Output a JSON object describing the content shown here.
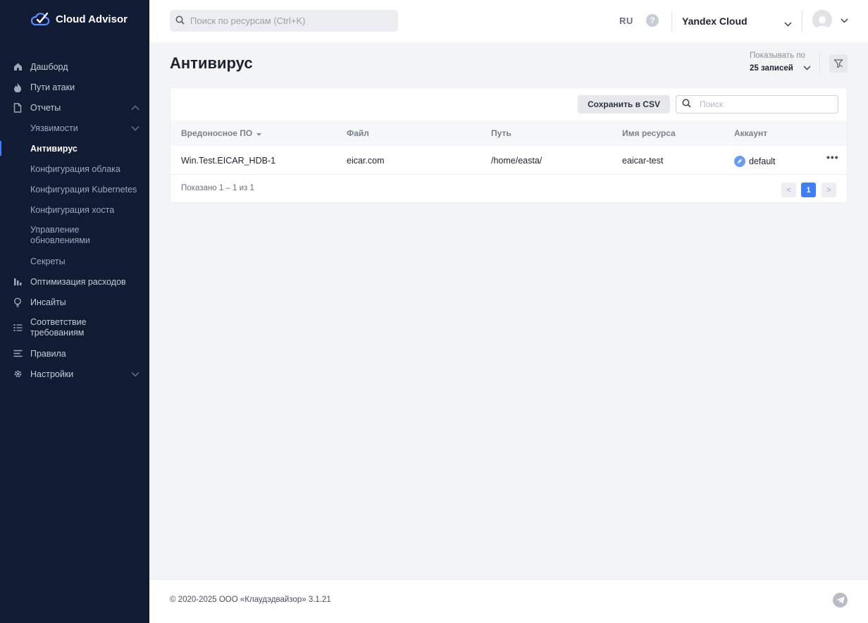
{
  "app": {
    "name": "Cloud Advisor"
  },
  "sidebar": {
    "items": [
      {
        "label": "Дашборд",
        "icon": "home-icon"
      },
      {
        "label": "Пути атаки",
        "icon": "flame-icon"
      },
      {
        "label": "Отчеты",
        "icon": "document-icon",
        "expanded": true
      },
      {
        "label": "Уязвимости",
        "sub": true,
        "expanded": false
      },
      {
        "label": "Антивирус",
        "sub": true,
        "active": true
      },
      {
        "label": "Конфигурация облака",
        "sub": true
      },
      {
        "label": "Конфигурация Kubernetes",
        "sub": true
      },
      {
        "label": "Конфигурация хоста",
        "sub": true
      },
      {
        "label": "Управление обновлениями",
        "sub": true
      },
      {
        "label": "Секреты",
        "sub": true
      },
      {
        "label": "Оптимизация расходов",
        "icon": "bar-chart-icon"
      },
      {
        "label": "Инсайты",
        "icon": "lightbulb-icon"
      },
      {
        "label": "Соответствие требованиям",
        "icon": "checklist-icon"
      },
      {
        "label": "Правила",
        "icon": "rules-icon"
      },
      {
        "label": "Настройки",
        "icon": "gear-icon",
        "expanded": false
      }
    ]
  },
  "header": {
    "search_placeholder": "Поиск по ресурсам (Ctrl+K)",
    "lang": "RU",
    "help": "?",
    "cloud": "Yandex Cloud"
  },
  "main": {
    "title": "Антивирус",
    "show_by_label": "Показывать по",
    "show_by_value": "25 записей",
    "csv_button": "Сохранить в CSV",
    "table_search_placeholder": "Поиск",
    "columns": [
      "Вредоносное ПО",
      "Файл",
      "Путь",
      "Имя ресурса",
      "Аккаунт"
    ],
    "rows": [
      {
        "malware": "Win.Test.EICAR_HDB-1",
        "file": "eicar.com",
        "path": "/home/easta/",
        "resource": "eaicar-test",
        "account": "default"
      }
    ],
    "shown_text": "Показано 1 – 1 из 1",
    "pagination": {
      "prev": "<",
      "current": "1",
      "next": ">"
    }
  },
  "footer": {
    "copyright": "© 2020-2025 ООО «Клаудэдвайзор» 3.1.21"
  },
  "colors": {
    "sidebar": "#111c33",
    "accent": "#3d7eff"
  }
}
